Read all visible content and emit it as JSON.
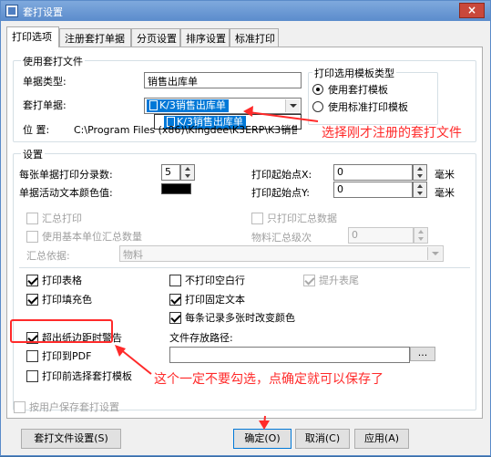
{
  "window": {
    "title": "套打设置",
    "close_label": "×"
  },
  "tabs": [
    {
      "label": "打印选项"
    },
    {
      "label": "注册套打单据"
    },
    {
      "label": "分页设置"
    },
    {
      "label": "排序设置"
    },
    {
      "label": "标准打印"
    }
  ],
  "use_template": {
    "group_label": "使用套打文件",
    "doc_type_label": "单据类型:",
    "doc_type_value": "销售出库单",
    "template_label": "套打单据:",
    "template_value": "K/3销售出库单",
    "template_option": "K/3销售出库单",
    "location_label": "位   置:",
    "location_value": "C:\\Program Files (x86)\\Kingdee\\K3ERP\\K3销售出库单.NDF"
  },
  "print_template": {
    "group_label": "打印选用模板类型",
    "options": [
      "使用套打模板",
      "使用标准打印模板"
    ],
    "selected": 0
  },
  "settings": {
    "group_label": "设置",
    "per_doc_records_label": "每张单据打印分录数:",
    "per_doc_records_value": "5",
    "text_color_label": "单据活动文本颜色值:",
    "text_color": "#000000",
    "start_x_label": "打印起始点X:",
    "start_x_value": "0",
    "start_x_unit": "毫米",
    "start_y_label": "打印起始点Y:",
    "start_y_value": "0",
    "start_y_unit": "毫米",
    "summary_print": "汇总打印",
    "print_summary_only": "只打印汇总数据",
    "use_base_unit": "使用基本单位汇总数量",
    "material_level_label": "物料汇总级次",
    "material_level_value": "0",
    "summary_basis_label": "汇总依据:",
    "summary_basis_value": "物料"
  },
  "options": {
    "print_table": "打印表格",
    "print_fill_color": "打印填充色",
    "no_blank_rows": "不打印空白行",
    "print_fixed_text": "打印固定文本",
    "change_color": "每条记录多张时改变颜色",
    "raise_footer": "提升表尾",
    "margin_warning": "超出纸边距时警告",
    "print_pdf": "打印到PDF",
    "choose_template": "打印前选择套打模板",
    "file_path_label": "文件存放路径:",
    "file_path_value": "",
    "browse_label": "...",
    "user_save": "按用户保存套打设置"
  },
  "buttons": {
    "file_settings": "套打文件设置(S)",
    "ok": "确定(O)",
    "cancel": "取消(C)",
    "apply": "应用(A)"
  },
  "annotations": {
    "select_text": "选择刚才注册的套打文件",
    "uncheck_text": "这个一定不要勾选，点确定就可以保存了",
    "color": "#ff2a2a"
  }
}
